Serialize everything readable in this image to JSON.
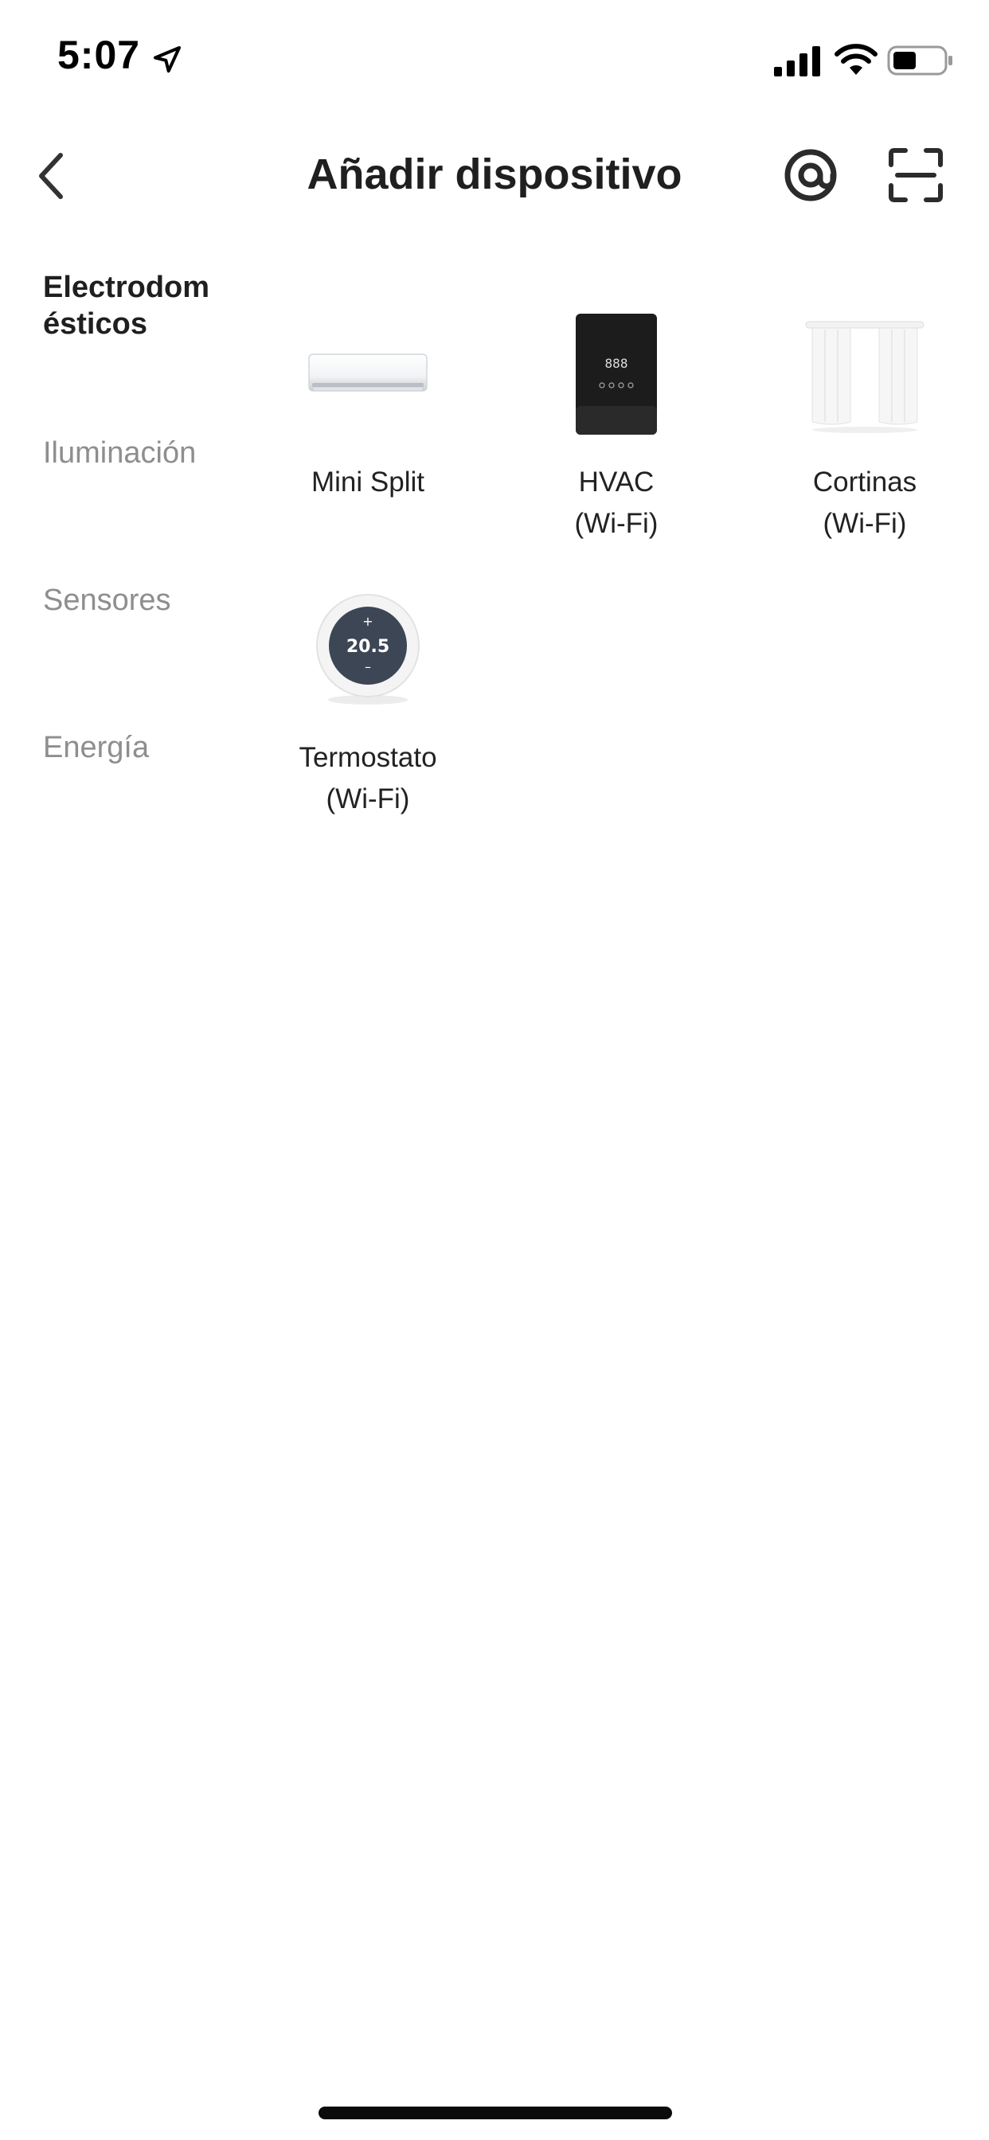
{
  "status_bar": {
    "time": "5:07",
    "icons": [
      "location-icon",
      "signal-icon",
      "wifi-icon",
      "battery-icon"
    ]
  },
  "header": {
    "title": "Añadir dispositivo",
    "back_icon": "chevron-left-icon",
    "at_icon": "at-sign-icon",
    "scan_icon": "scan-icon"
  },
  "sidebar": {
    "items": [
      {
        "label": "Electrodom\nésticos",
        "active": true
      },
      {
        "label": "Iluminación",
        "active": false
      },
      {
        "label": "Sensores",
        "active": false
      },
      {
        "label": "Energía",
        "active": false
      }
    ]
  },
  "devices": [
    {
      "label": "Mini Split",
      "icon": "mini-split-image"
    },
    {
      "label": "HVAC\n(Wi-Fi)",
      "icon": "hvac-panel-image",
      "panel_text": "888"
    },
    {
      "label": "Cortinas\n(Wi-Fi)",
      "icon": "curtains-image"
    },
    {
      "label": "Termostato\n(Wi-Fi)",
      "icon": "thermostat-image",
      "display": {
        "plus": "+",
        "value": "20.5",
        "minus": "–"
      }
    }
  ],
  "colors": {
    "text_active": "#1f1f1f",
    "text_inactive": "#8e8e8e",
    "background": "#ffffff"
  }
}
